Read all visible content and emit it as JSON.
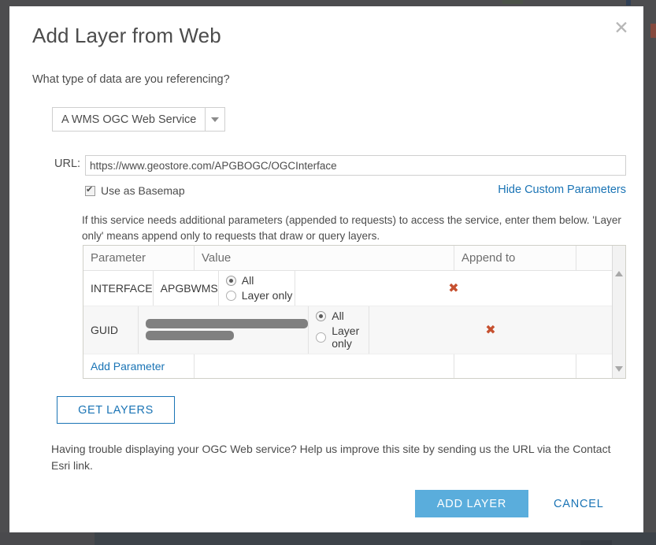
{
  "dialog": {
    "title": "Add Layer from Web",
    "close_icon": "close-icon",
    "question": "What type of data are you referencing?",
    "service_type": {
      "selected": "A WMS OGC Web Service",
      "caret_icon": "chevron-down-icon"
    },
    "url": {
      "label": "URL:",
      "value": "https://www.geostore.com/APGBOGC/OGCInterface",
      "placeholder": "https://"
    },
    "basemap": {
      "label": "Use as Basemap",
      "checked": true
    },
    "hide_params_link": "Hide Custom Parameters",
    "description": "If this service needs additional parameters (appended to requests) to access the service, enter them below. 'Layer only' means append only to requests that draw or query layers.",
    "params_table": {
      "headers": [
        "Parameter",
        "Value",
        "Append to",
        ""
      ],
      "rows": [
        {
          "parameter": "INTERFACE",
          "value": "APGBWMS",
          "value_redacted": false,
          "append_to": "All",
          "options": [
            "All",
            "Layer only"
          ],
          "delete_icon": "delete-x-icon"
        },
        {
          "parameter": "GUID",
          "value": "",
          "value_redacted": true,
          "redaction_bars": [
            206,
            112
          ],
          "append_to": "All",
          "options": [
            "All",
            "Layer only"
          ],
          "delete_icon": "delete-x-icon"
        }
      ],
      "add_parameter_link": "Add Parameter",
      "scrollbar": {
        "up_icon": "scroll-up-arrow-icon",
        "down_icon": "scroll-down-arrow-icon"
      }
    },
    "get_layers_label": "GET LAYERS",
    "help_text": "Having trouble displaying your OGC Web service? Help us improve this site by sending us the URL via the Contact Esri link.",
    "add_layer_label": "ADD LAYER",
    "cancel_label": "CANCEL"
  },
  "colors": {
    "accent_blue": "#1a74b5",
    "primary_button": "#5aaddc",
    "delete_red": "#c6502f",
    "text": "#4c4c4c",
    "overlay": "#4a4a4c"
  }
}
